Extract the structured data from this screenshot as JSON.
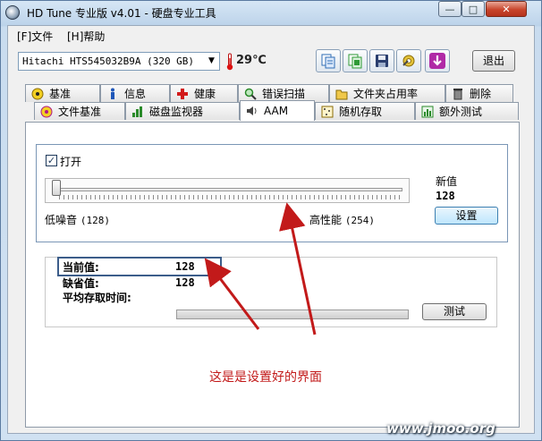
{
  "window": {
    "title": "HD Tune 专业版 v4.01 - 硬盘专业工具",
    "minimize": "—",
    "maximize": "□",
    "close": "✕"
  },
  "menu": [
    "[F]文件",
    "[H]帮助"
  ],
  "toolbar": {
    "drive": "Hitachi HTS545032B9A   (320 GB)",
    "dropdown_arrow": "▼",
    "temperature": "29℃",
    "buttons": [
      {
        "name": "copy-text-icon",
        "color": "#2f6db6"
      },
      {
        "name": "copy-screenshot-icon",
        "color": "#2f9a36"
      },
      {
        "name": "save-icon",
        "color": "#2a3e6e"
      },
      {
        "name": "options-icon",
        "color": "#c9a21a"
      },
      {
        "name": "download-icon",
        "color": "#b02aa6"
      }
    ],
    "exit_label": "退出"
  },
  "tabs_top": [
    {
      "label": "基准",
      "icon": "benchmark-icon",
      "color": "#d8b000"
    },
    {
      "label": "信息",
      "icon": "info-icon",
      "color": "#1e56b8"
    },
    {
      "label": "健康",
      "icon": "health-icon",
      "color": "#d21a1a"
    },
    {
      "label": "错误扫描",
      "icon": "error-scan-icon",
      "color": "#2a8a2a"
    },
    {
      "label": "文件夹占用率",
      "icon": "folder-usage-icon",
      "color": "#c9a21a"
    },
    {
      "label": "删除",
      "icon": "erase-icon",
      "color": "#555555"
    }
  ],
  "tabs_bottom": [
    {
      "label": "文件基准",
      "icon": "file-benchmark-icon",
      "color": "#b0148a"
    },
    {
      "label": "磁盘监视器",
      "icon": "disk-monitor-icon",
      "color": "#2a8a2a"
    },
    {
      "label": "AAM",
      "icon": "speaker-icon",
      "color": "#333333",
      "active": true
    },
    {
      "label": "随机存取",
      "icon": "random-access-icon",
      "color": "#c9a21a"
    },
    {
      "label": "额外测试",
      "icon": "extra-tests-icon",
      "color": "#2a8a2a"
    }
  ],
  "aam": {
    "enable_label": "打开",
    "enabled": true,
    "check_mark": "✓",
    "slider_position": 0.0,
    "low_label": "低噪音",
    "low_value": "(128)",
    "high_label": "高性能",
    "high_value": "(254)",
    "new_value_label": "新值",
    "new_value": "128",
    "set_button": "设置"
  },
  "info": {
    "current_label": "当前值:",
    "current_value": "128",
    "default_label": "缺省值:",
    "default_value": "128",
    "access_time_label": "平均存取时间:",
    "test_button": "测试"
  },
  "annotation": "这是是设置好的界面",
  "watermark": "www.jmoo.org",
  "colors": {
    "annotation": "#c21a1a",
    "arrow": "#c21a1a"
  }
}
